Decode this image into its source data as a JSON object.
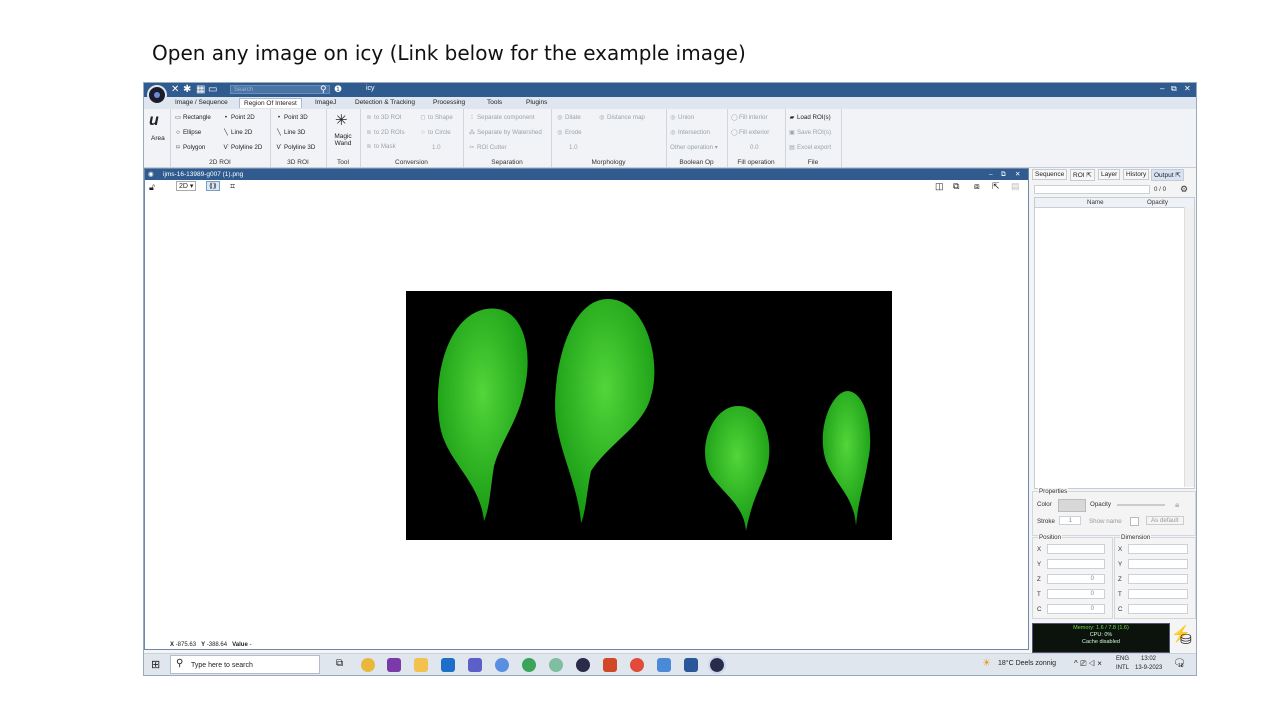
{
  "slide": {
    "caption": "Open any image on icy (Link below for the example image)"
  },
  "app": {
    "title": "icy",
    "search_placeholder": "Search"
  },
  "menu": {
    "tabs": [
      "Image / Sequence",
      "Region Of Interest",
      "ImageJ",
      "Detection & Tracking",
      "Processing",
      "Tools",
      "Plugins"
    ],
    "active": "Region Of Interest"
  },
  "ribbon": {
    "area": {
      "label": "Area"
    },
    "roi2d": {
      "items": [
        "Rectangle",
        "Ellipse",
        "Polygon",
        "Point 2D",
        "Line 2D",
        "Polyline 2D"
      ],
      "label": "2D ROI"
    },
    "roi3d": {
      "items": [
        "Point 3D",
        "Line 3D",
        "Polyline 3D"
      ],
      "label": "3D ROI"
    },
    "tool": {
      "magic": "Magic",
      "wand": "Wand",
      "label": "Tool"
    },
    "conversion": {
      "items": [
        "to 3D ROI",
        "to 2D ROIs",
        "to Mask",
        "to Shape",
        "to Circle"
      ],
      "value": "1.0",
      "label": "Conversion"
    },
    "separation": {
      "items": [
        "Separate component",
        "Separate by Watershed",
        "ROI Cutter"
      ],
      "label": "Separation"
    },
    "morphology": {
      "items": [
        "Dilate",
        "Erode",
        "Distance map"
      ],
      "value": "1.0",
      "label": "Morphology"
    },
    "boolean": {
      "items": [
        "Union",
        "Intersection",
        "Other operation"
      ],
      "label": "Boolean Op"
    },
    "fill": {
      "items": [
        "Fill interior",
        "Fill exterior"
      ],
      "value": "0.0",
      "label": "Fill operation"
    },
    "file": {
      "items": [
        "Load ROI(s)",
        "Save ROI(s)",
        "Excel export"
      ],
      "label": "File"
    }
  },
  "viewer": {
    "title": "ijms-16-13989-g007 (1).png",
    "mode": "2D",
    "status": {
      "x_label": "X",
      "x": "-875.63",
      "y_label": "Y",
      "y": "-388.64",
      "value_label": "Value",
      "value": "-"
    }
  },
  "right_panel": {
    "tabs": [
      "Sequence",
      "ROI",
      "Layer",
      "History",
      "Output"
    ],
    "active": "Output",
    "count": "0 / 0",
    "columns": [
      "Name",
      "Opacity"
    ],
    "properties": {
      "title": "Properties",
      "color": "Color",
      "opacity": "Opacity",
      "stroke": "Stroke",
      "stroke_value": "1",
      "show_name": "Show name",
      "as_default": "As default"
    },
    "position": {
      "title": "Position",
      "rows": [
        "X",
        "Y",
        "Z",
        "T",
        "C"
      ],
      "values": [
        "",
        "",
        "0",
        "0",
        "0"
      ]
    },
    "dimension": {
      "title": "Dimension",
      "rows": [
        "X",
        "Y",
        "Z",
        "T",
        "C"
      ]
    },
    "memory": {
      "line1": "Memory: 1.6 / 7.8 (1.6)",
      "line2": "CPU: 0%",
      "line3": "Cache disabled"
    }
  },
  "taskbar": {
    "search": "Type here to search",
    "weather": "18°C  Deels zonnig",
    "lang1": "ENG",
    "lang2": "INTL",
    "time": "13:02",
    "date": "13-9-2023",
    "notif": "18"
  }
}
